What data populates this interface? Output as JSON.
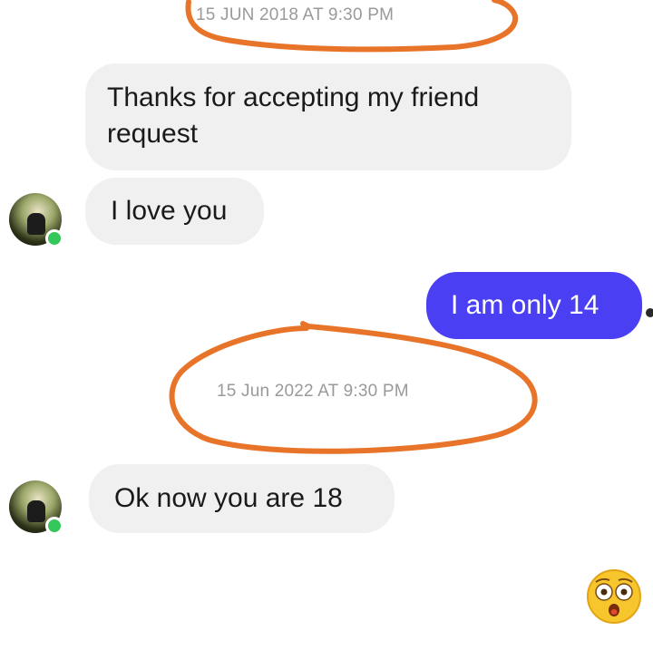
{
  "conversation": {
    "timestamps": [
      "15 JUN 2018  AT 9:30 PM",
      "15 Jun 2022 AT 9:30 PM"
    ],
    "messages": [
      {
        "sender": "them",
        "text": "Thanks for accepting my friend request"
      },
      {
        "sender": "them",
        "text": "I love you"
      },
      {
        "sender": "me",
        "text": "I am only 14"
      },
      {
        "sender": "them",
        "text": "Ok now you are 18"
      }
    ]
  },
  "overlays": {
    "annotation_color": "#e8742a",
    "reaction_emoji": "flushed-face-icon"
  },
  "colors": {
    "sent_bubble": "#4b3ff3",
    "received_bubble": "#f1f0f0",
    "online_indicator": "#34c759"
  }
}
